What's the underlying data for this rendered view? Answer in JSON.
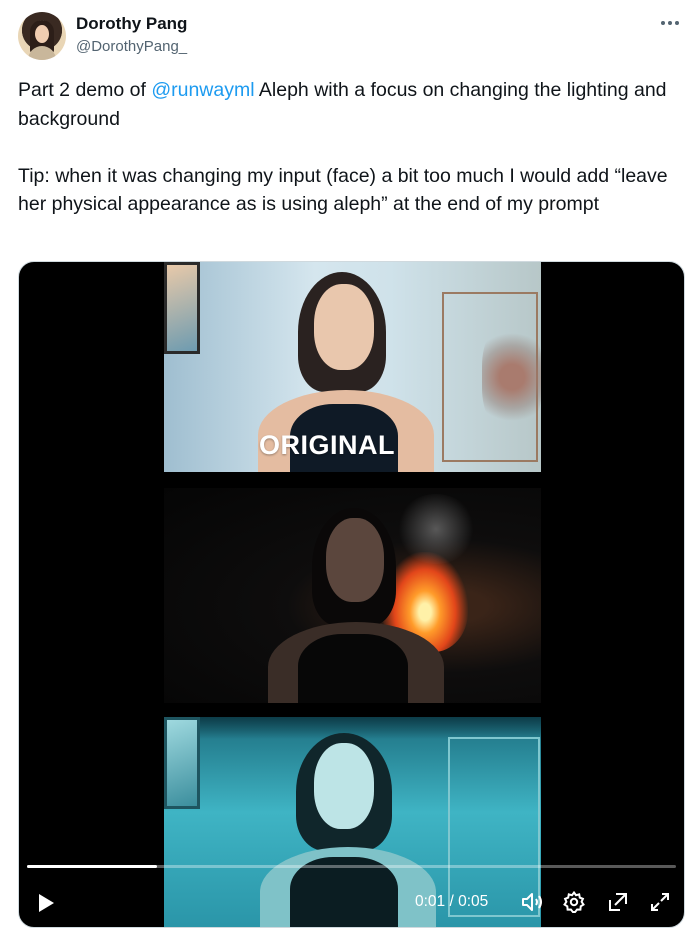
{
  "author": {
    "name": "Dorothy Pang",
    "handle": "@DorothyPang_"
  },
  "more_icon": "more-horizontal-icon",
  "tweet": {
    "line1_prefix": "Part 2 demo of ",
    "mention": "@runwayml",
    "line1_suffix": " Aleph with a focus on changing the lighting and background",
    "paragraph2": "Tip: when it was changing my input (face) a bit too much I would add “leave her physical appearance as is using aleph” at the end of my prompt"
  },
  "video": {
    "overlay_label": "ORIGINAL",
    "time_display": "0:01 / 0:05",
    "progress": 0.2,
    "icons": {
      "play": "play-icon",
      "volume": "volume-icon",
      "settings": "settings-icon",
      "pip": "picture-in-picture-icon",
      "fullscreen": "fullscreen-icon"
    }
  },
  "colors": {
    "link": "#1d9bf0",
    "text": "#0f1419",
    "muted": "#536471"
  }
}
